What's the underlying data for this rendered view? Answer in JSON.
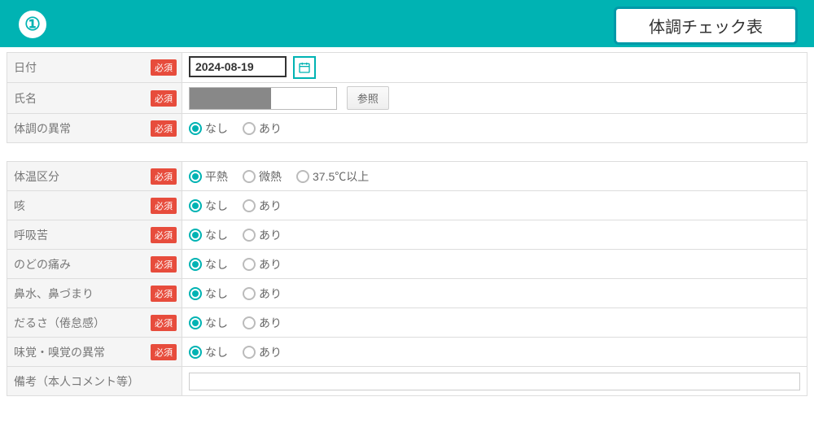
{
  "header": {
    "badge": "①",
    "title": "体調チェック表"
  },
  "required_label": "必須",
  "fields": {
    "date": {
      "label": "日付",
      "value": "2024-08-19",
      "required": true
    },
    "name": {
      "label": "氏名",
      "ref_button": "参照",
      "required": true
    },
    "abnormal": {
      "label": "体調の異常",
      "required": true,
      "options": [
        "なし",
        "あり"
      ],
      "selected": 0
    },
    "temp": {
      "label": "体温区分",
      "required": true,
      "options": [
        "平熱",
        "微熱",
        "37.5℃以上"
      ],
      "selected": 0
    },
    "cough": {
      "label": "咳",
      "required": true,
      "options": [
        "なし",
        "あり"
      ],
      "selected": 0
    },
    "breath": {
      "label": "呼吸苦",
      "required": true,
      "options": [
        "なし",
        "あり"
      ],
      "selected": 0
    },
    "throat": {
      "label": "のどの痛み",
      "required": true,
      "options": [
        "なし",
        "あり"
      ],
      "selected": 0
    },
    "nose": {
      "label": "鼻水、鼻づまり",
      "required": true,
      "options": [
        "なし",
        "あり"
      ],
      "selected": 0
    },
    "fatigue": {
      "label": "だるさ（倦怠感）",
      "required": true,
      "options": [
        "なし",
        "あり"
      ],
      "selected": 0
    },
    "taste": {
      "label": "味覚・嗅覚の異常",
      "required": true,
      "options": [
        "なし",
        "あり"
      ],
      "selected": 0
    },
    "remarks": {
      "label": "備考（本人コメント等）",
      "required": false
    }
  }
}
